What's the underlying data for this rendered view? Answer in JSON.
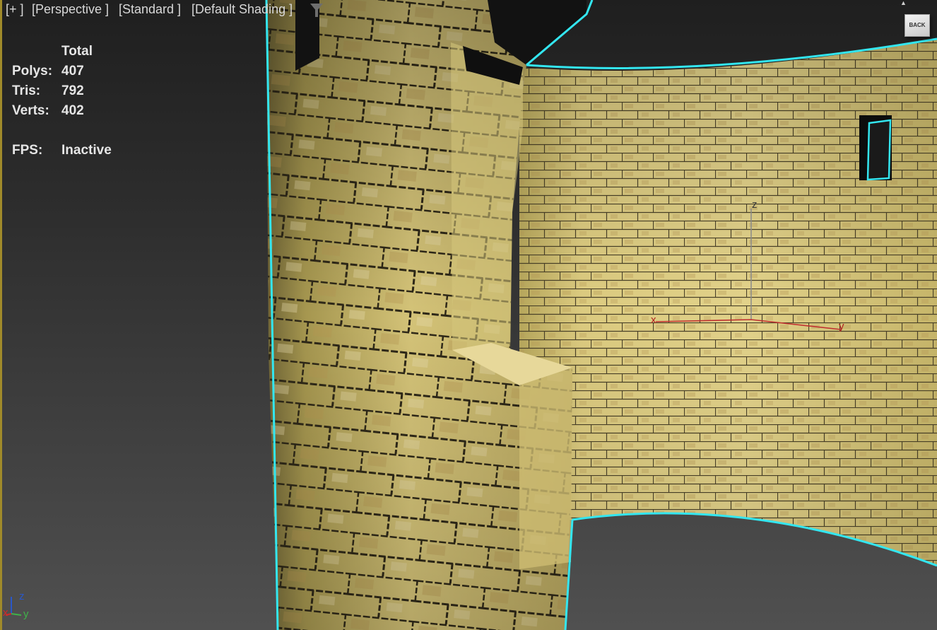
{
  "viewport": {
    "menu_plus": "[+ ]",
    "menu_view": "[Perspective ]",
    "menu_visual_style": "[Standard ]",
    "menu_shading": "[Default Shading ]",
    "filter_icon": "funnel-icon"
  },
  "stats": {
    "header": "Total",
    "polys_label": "Polys:",
    "polys_value": "407",
    "tris_label": "Tris:",
    "tris_value": "792",
    "verts_label": "Verts:",
    "verts_value": "402",
    "fps_label": "FPS:",
    "fps_value": "Inactive"
  },
  "viewcube": {
    "face_label": "BACK",
    "home_icon": "home-icon"
  },
  "gizmo": {
    "x_label": "x",
    "y_label": "y",
    "z_label": "z"
  },
  "axis_tripod": {
    "x_label": "x",
    "y_label": "y",
    "z_label": "z"
  },
  "colors": {
    "selection_outline": "#33e6f0",
    "brick_base": "#d8c77a",
    "brick_shadow": "#9e8f4d",
    "mortar": "#3a3320",
    "axis_x": "#d02a2a",
    "axis_y": "#3fb24a",
    "axis_z": "#2a57c8",
    "gizmo_line": "#c03030"
  }
}
